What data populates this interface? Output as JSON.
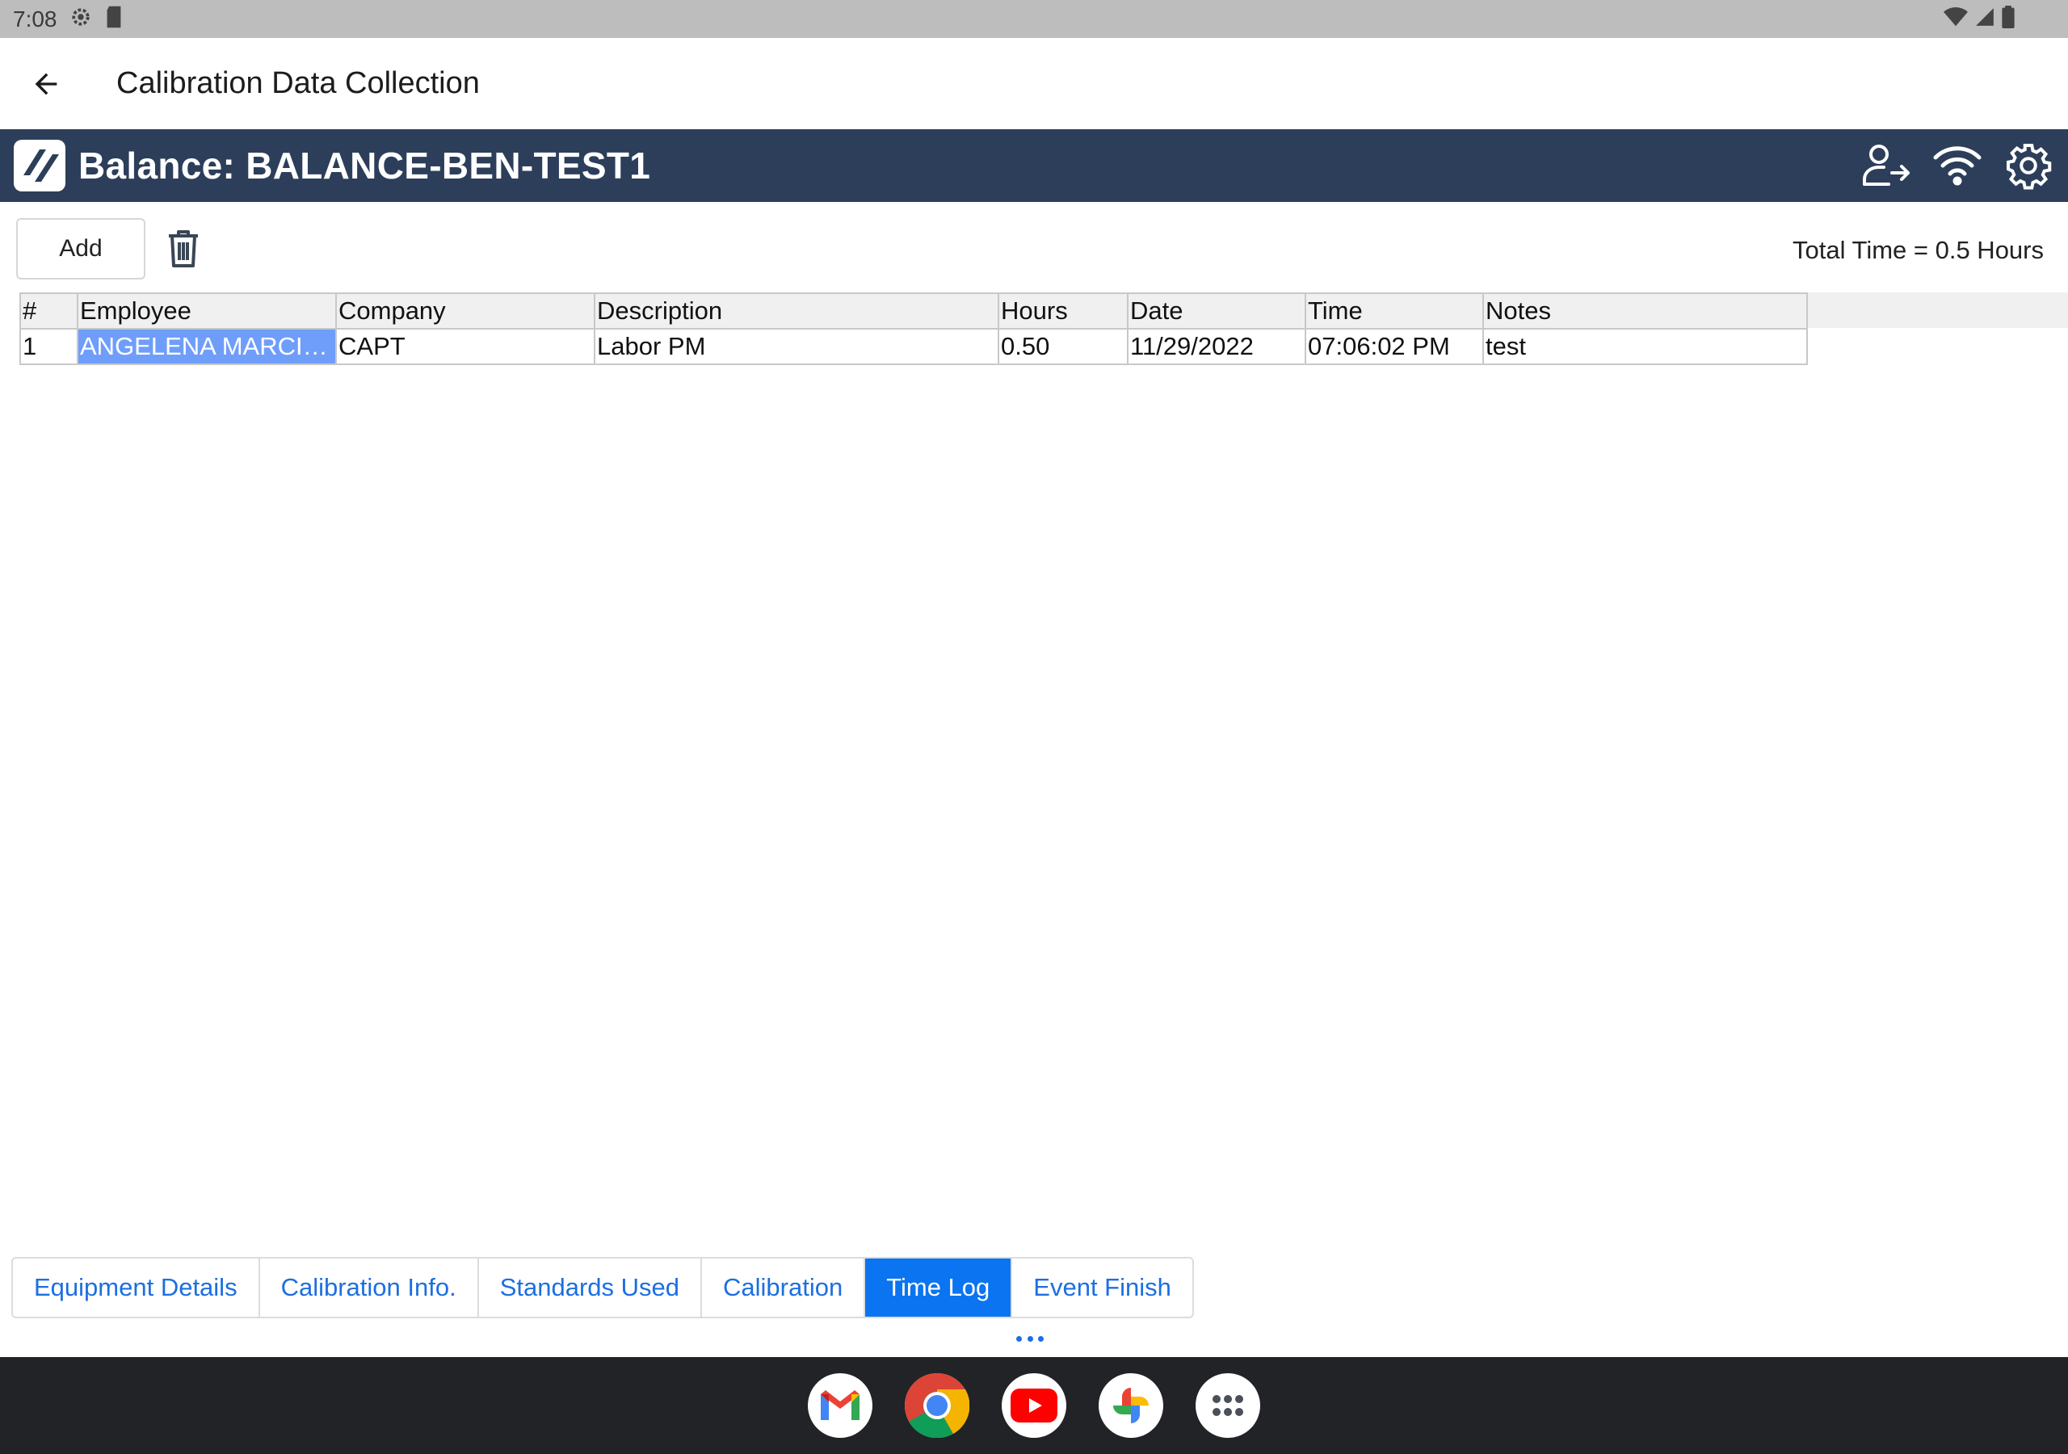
{
  "status_bar": {
    "time": "7:08"
  },
  "app_bar": {
    "title": "Calibration Data Collection"
  },
  "header": {
    "title": "Balance: BALANCE-BEN-TEST1"
  },
  "toolbar": {
    "add_label": "Add",
    "total_time": "Total Time = 0.5 Hours"
  },
  "table": {
    "columns": [
      "#",
      "Employee",
      "Company",
      "Description",
      "Hours",
      "Date",
      "Time",
      "Notes"
    ],
    "rows": [
      {
        "num": "1",
        "employee": "ANGELENA MARCIA...",
        "company": "CAPT",
        "description": "Labor PM",
        "hours": "0.50",
        "date": "11/29/2022",
        "time": "07:06:02 PM",
        "notes": "test"
      }
    ]
  },
  "tabs": [
    {
      "label": "Equipment Details"
    },
    {
      "label": "Calibration Info."
    },
    {
      "label": "Standards Used"
    },
    {
      "label": "Calibration"
    },
    {
      "label": "Time Log",
      "active": true
    },
    {
      "label": "Event Finish"
    }
  ],
  "icons": {
    "status_left": [
      "gear-icon",
      "sd-card-icon"
    ],
    "status_right": [
      "wifi-icon",
      "signal-icon",
      "battery-icon"
    ],
    "header_right": [
      "user-logout-icon",
      "wifi-icon",
      "settings-icon"
    ],
    "dock": [
      "gmail-icon",
      "chrome-icon",
      "youtube-icon",
      "photos-icon",
      "app-drawer-icon"
    ]
  },
  "colors": {
    "header_band": "#2c3e5a",
    "accent": "#0b74f1",
    "selection": "#6f9dfa",
    "taskbar": "#222326"
  }
}
